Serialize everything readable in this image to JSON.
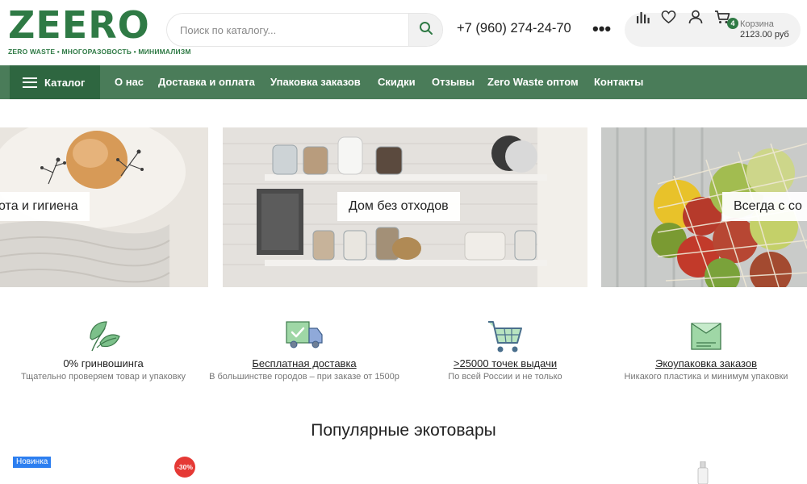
{
  "header": {
    "logo_text": "ZEERO",
    "logo_tagline": "ZERO WASTE • МНОГОРАЗОВОСТЬ • МИНИМАЛИЗМ",
    "search_placeholder": "Поиск по каталогу...",
    "phone": "+7 (960) 274-24-70",
    "more_label": "•••",
    "cart": {
      "label": "Корзина",
      "total": "2123.00 руб",
      "count": "4"
    },
    "icons": [
      "search-icon",
      "compare-icon",
      "heart-icon",
      "user-icon",
      "cart-icon"
    ]
  },
  "nav": {
    "catalog_label": "Каталог",
    "items": [
      "О нас",
      "Доставка и оплата",
      "Упаковка заказов",
      "Скидки",
      "Отзывы",
      "Zero Waste оптом",
      "Контакты"
    ]
  },
  "banners": [
    {
      "label": "ота и гигиена"
    },
    {
      "label": "Дом без отходов"
    },
    {
      "label": "Всегда с со"
    }
  ],
  "features": [
    {
      "title": "0% гринвошинга",
      "desc": "Тщательно проверяем товар и упаковку",
      "icon": "leaf-icon"
    },
    {
      "title": "Бесплатная доставка",
      "desc": "В большинстве городов – при заказе от 1500р",
      "icon": "delivery-truck-icon"
    },
    {
      "title": ">25000 точек выдачи",
      "desc": "По всей России и не только",
      "icon": "shopping-cart-icon"
    },
    {
      "title": "Экоупаковка заказов",
      "desc": "Никакого пластика и минимум упаковки",
      "icon": "eco-package-icon"
    }
  ],
  "popular": {
    "title": "Популярные экотовары",
    "badge_new": "Новинка",
    "badge_sale": "-30%"
  },
  "colors": {
    "brand_green": "#2f7a45",
    "nav_bg": "#4a7c59",
    "catalog_bg": "#2e6640",
    "icon_green": "#7cc08a",
    "badge_new": "#2d7ff0",
    "badge_sale": "#e53935"
  }
}
